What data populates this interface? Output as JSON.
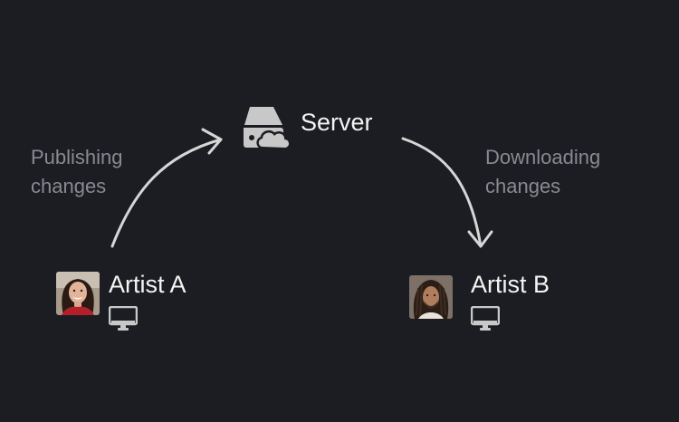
{
  "nodes": {
    "server": {
      "label": "Server",
      "icon": "server-cloud-icon"
    },
    "artist_a": {
      "label": "Artist A",
      "avatar": "avatar-woman-smiling",
      "device_icon": "monitor-icon"
    },
    "artist_b": {
      "label": "Artist B",
      "avatar": "avatar-man-dreadlocks",
      "device_icon": "monitor-icon"
    }
  },
  "edges": {
    "publish": {
      "from": "Artist A",
      "to": "Server",
      "label_line1": "Publishing",
      "label_line2": "changes"
    },
    "download": {
      "from": "Server",
      "to": "Artist B",
      "label_line1": "Downloading",
      "label_line2": "changes"
    }
  },
  "colors": {
    "background": "#1c1d22",
    "text": "#f4f4f4",
    "muted_text": "#878a90",
    "arrow": "#d6d6d6",
    "icon": "#c8c8c8"
  }
}
